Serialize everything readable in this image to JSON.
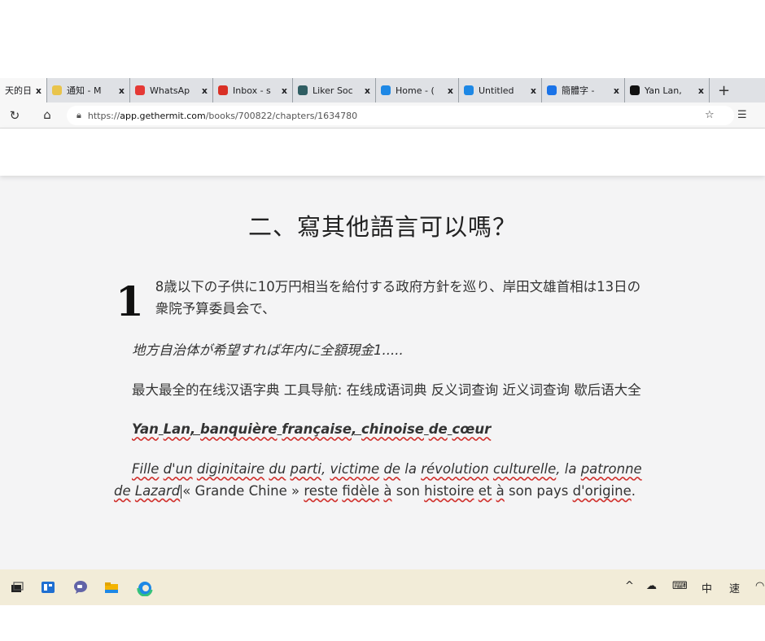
{
  "browser": {
    "tabs": [
      {
        "label": "天的日",
        "icon": "page-icon",
        "color": "#ffffff",
        "active": true
      },
      {
        "label": "通知 - M",
        "icon": "notification-icon",
        "color": "#e9c44b",
        "active": false
      },
      {
        "label": "WhatsAp",
        "icon": "whatsapp-icon",
        "color": "#e53935",
        "active": false
      },
      {
        "label": "Inbox - s",
        "icon": "gmail-icon",
        "color": "#d93025",
        "active": false
      },
      {
        "label": "Liker Soc",
        "icon": "liker-icon",
        "color": "#2f5d62",
        "active": false
      },
      {
        "label": "Home - (",
        "icon": "edge-icon",
        "color": "#1e88e5",
        "active": false
      },
      {
        "label": "Untitled",
        "icon": "edge-icon",
        "color": "#1e88e5",
        "active": false
      },
      {
        "label": "簡體字 -",
        "icon": "bing-icon",
        "color": "#1a73e8",
        "active": false
      },
      {
        "label": "Yan Lan,",
        "icon": "m-icon",
        "color": "#111111",
        "active": false
      }
    ],
    "tab_close": "x",
    "new_tab": "+",
    "url": {
      "scheme": "https://",
      "host": "app.gethermit.com",
      "path": "/books/700822/chapters/1634780"
    }
  },
  "chapter": {
    "title": "二、寫其他語言可以嗎？",
    "dropcap": "1",
    "p1": "8歳以下の子供に10万円相当を給付する政府方針を巡り、岸田文雄首相は13日の衆院予算委員会で、",
    "p2": "地方自治体が希望すれば年内に全額現金1.....",
    "p3": "最大最全的在线汉语字典 工具导航: 在线成语词典 反义词查询 近义词查询 歇后语大全",
    "p4": [
      "Yan",
      " ",
      "Lan",
      ", ",
      "banquière",
      " ",
      "française",
      ", ",
      "chinoise",
      " ",
      "de",
      " ",
      "cœur"
    ],
    "p5": [
      {
        "t": "Fille",
        "s": true
      },
      {
        "t": " ",
        "s": false
      },
      {
        "t": "d'un",
        "s": true
      },
      {
        "t": " ",
        "s": false
      },
      {
        "t": "diginitaire",
        "s": true
      },
      {
        "t": " ",
        "s": false
      },
      {
        "t": "du",
        "s": true
      },
      {
        "t": " ",
        "s": false
      },
      {
        "t": "parti",
        "s": true
      },
      {
        "t": ", ",
        "s": false
      },
      {
        "t": "victime",
        "s": true
      },
      {
        "t": " ",
        "s": false
      },
      {
        "t": "de",
        "s": true
      },
      {
        "t": " la ",
        "s": false
      },
      {
        "t": "révolution",
        "s": true
      },
      {
        "t": " ",
        "s": false
      },
      {
        "t": "culturelle",
        "s": true
      },
      {
        "t": ", la ",
        "s": false
      },
      {
        "t": "patronne",
        "s": true
      },
      {
        "t": " ",
        "s": false
      },
      {
        "t": "de",
        "s": true
      },
      {
        "t": " ",
        "s": false
      },
      {
        "t": "Lazard",
        "s": true
      }
    ],
    "p5_tail": [
      {
        "t": "« Grande Chine » ",
        "s": false
      },
      {
        "t": "reste",
        "s": true
      },
      {
        "t": " ",
        "s": false
      },
      {
        "t": "fidèle",
        "s": true
      },
      {
        "t": " ",
        "s": false
      },
      {
        "t": "à",
        "s": true
      },
      {
        "t": " son ",
        "s": false
      },
      {
        "t": "histoire",
        "s": true
      },
      {
        "t": " ",
        "s": false
      },
      {
        "t": "et",
        "s": true
      },
      {
        "t": " ",
        "s": false
      },
      {
        "t": "à",
        "s": true
      },
      {
        "t": " son pays ",
        "s": false
      },
      {
        "t": "d'origine",
        "s": true
      },
      {
        "t": ".",
        "s": false
      }
    ]
  },
  "taskbar": {
    "apps": [
      "task-view-icon",
      "widgets-icon",
      "teams-chat-icon",
      "file-explorer-icon",
      "edge-icon"
    ],
    "tray": {
      "chevron": "^",
      "ime": "中",
      "ime_mode": "速"
    }
  },
  "colors": {
    "spellcheck": "#d0312d",
    "taskbar": "#f2ecd8",
    "page_bg": "#f4f4f5"
  }
}
